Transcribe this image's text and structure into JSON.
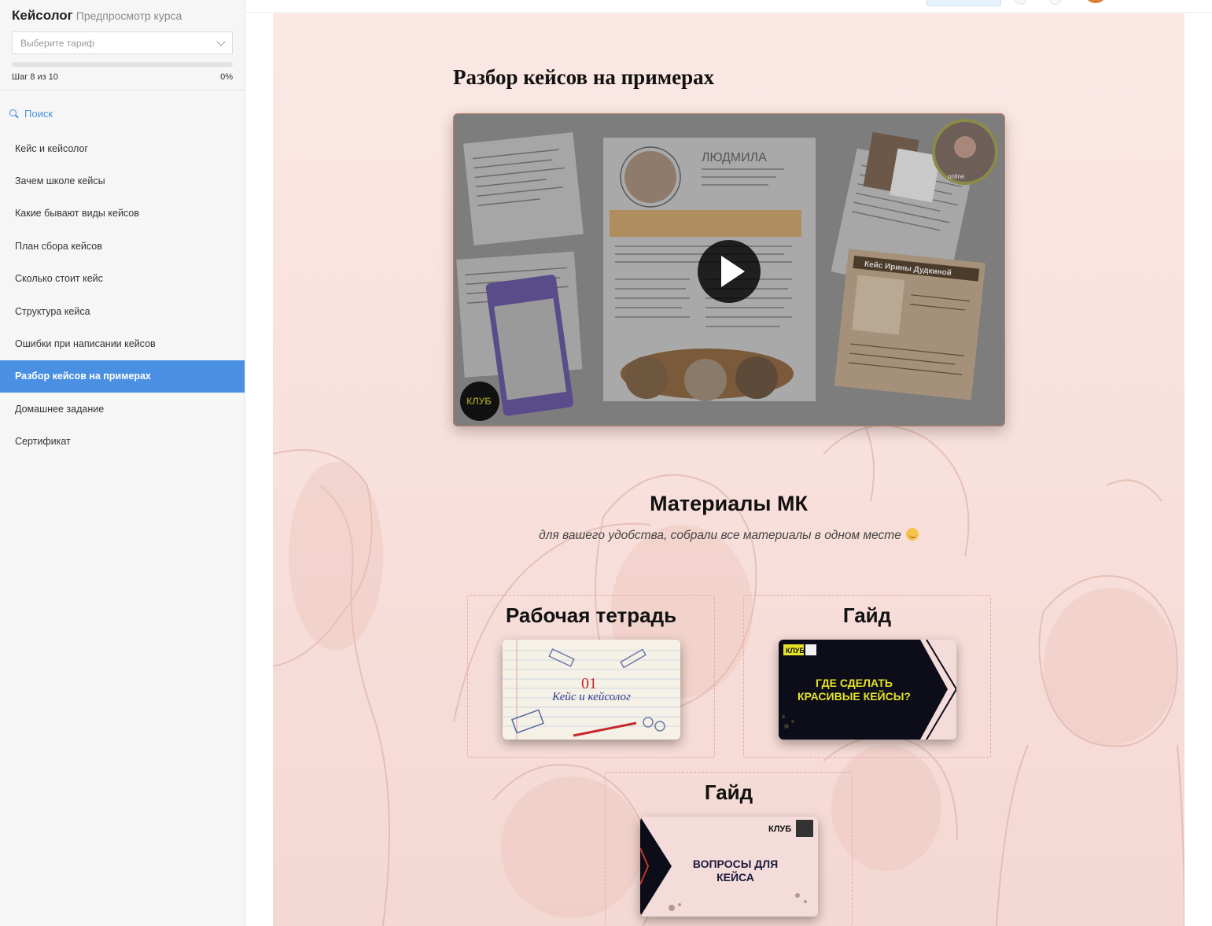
{
  "sidebar": {
    "course_title": "Кейсолог",
    "course_subtitle": "Предпросмотр курса",
    "tariff_placeholder": "Выберите тариф",
    "step_text": "Шаг 8 из 10",
    "progress_percent_text": "0%",
    "progress_value": 0,
    "search_label": "Поиск",
    "items": [
      {
        "label": "Кейс и кейсолог",
        "active": false
      },
      {
        "label": "Зачем школе кейсы",
        "active": false
      },
      {
        "label": "Какие бывают виды кейсов",
        "active": false
      },
      {
        "label": "План сбора кейсов",
        "active": false
      },
      {
        "label": "Сколько стоит кейс",
        "active": false
      },
      {
        "label": "Структура кейса",
        "active": false
      },
      {
        "label": "Ошибки при написании кейсов",
        "active": false
      },
      {
        "label": "Разбор кейсов на примерах",
        "active": true
      },
      {
        "label": "Домашнее задание",
        "active": false
      },
      {
        "label": "Сертификат",
        "active": false
      }
    ]
  },
  "lesson": {
    "title": "Разбор кейсов на примерах",
    "video": {
      "slide_name": "ЛЮДМИЛА",
      "slide_card_title": "Кейс Ирины Дудкиной",
      "slide_logo": "КЛУБ",
      "slide_online": "online"
    }
  },
  "materials": {
    "title": "Материалы МК",
    "subtitle": "для вашего удобства, собрали все материалы в одном месте",
    "cards": [
      {
        "title": "Рабочая тетрадь",
        "thumb_number": "01",
        "thumb_text": "Кейс и кейсолог"
      },
      {
        "title": "Гайд",
        "thumb_logo": "КЛУБ",
        "thumb_line1": "ГДЕ СДЕЛАТЬ",
        "thumb_line2": "КРАСИВЫЕ КЕЙСЫ?"
      },
      {
        "title": "Гайд",
        "thumb_logo": "КЛУБ",
        "thumb_line1": "ВОПРОСЫ ДЛЯ",
        "thumb_line2": "КЕЙСА"
      }
    ]
  },
  "colors": {
    "accent": "#4a90e2",
    "content_bg": "#fbe8e5",
    "card_border": "#e8a9a5"
  }
}
